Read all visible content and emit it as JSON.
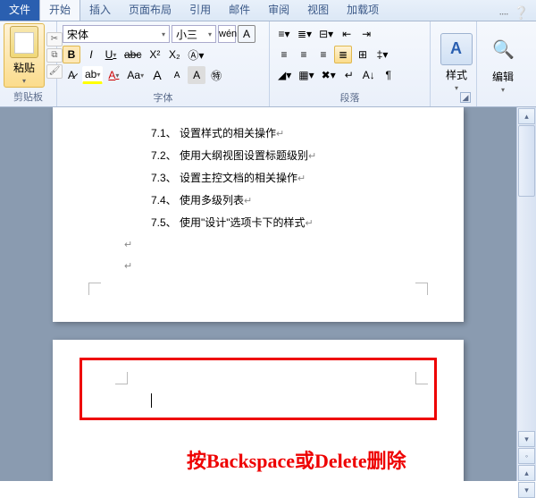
{
  "tabs": {
    "file": "文件",
    "home": "开始",
    "insert": "插入",
    "layout": "页面布局",
    "references": "引用",
    "mail": "邮件",
    "review": "审阅",
    "view": "视图",
    "addins": "加载项"
  },
  "clipboard": {
    "paste": "粘贴",
    "label": "剪贴板"
  },
  "font": {
    "name": "宋体",
    "size": "小三",
    "wen": "wén",
    "label": "字体",
    "B": "B",
    "I": "I",
    "U": "U",
    "abc": "abc",
    "x2": "X²",
    "x2b": "X₂",
    "Aa": "Aa",
    "Ap": "A",
    "Am": "A",
    "clearfmt": "A",
    "color": "A",
    "highlight": "ab",
    "circled": "㊕"
  },
  "paragraph": {
    "label": "段落"
  },
  "styles": {
    "label": "样式"
  },
  "editing": {
    "label": "编辑"
  },
  "toc": {
    "l1": "7.1、 设置样式的相关操作",
    "l2": "7.2、 使用大纲视图设置标题级别",
    "l3": "7.3、 设置主控文档的相关操作",
    "l4": "7.4、 使用多级列表",
    "l5": "7.5、 使用\"设计\"选项卡下的样式"
  },
  "mark": "↵",
  "caption": "按Backspace或Delete删除"
}
